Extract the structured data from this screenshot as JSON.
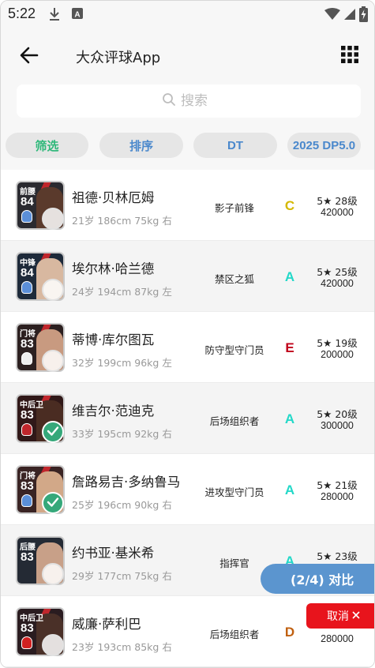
{
  "status_bar": {
    "time": "5:22",
    "icons": [
      "download-icon",
      "keyboard-a-icon",
      "wifi-icon",
      "signal-icon",
      "battery-charging-icon"
    ]
  },
  "app_bar": {
    "title": "大众评球App",
    "back_icon": "arrow-left-icon",
    "menu_icon": "grid-icon"
  },
  "search": {
    "placeholder": "搜索",
    "icon": "search-icon"
  },
  "chips": [
    {
      "label": "筛选",
      "color": "#2fb87a"
    },
    {
      "label": "排序",
      "color": "#4a88cc"
    },
    {
      "label": "DT",
      "color": "#4a88cc"
    },
    {
      "label": "2025 DP5.0",
      "color": "#4a88cc"
    }
  ],
  "players": [
    {
      "card_pos": "前腰",
      "card_rating": "84",
      "name": "祖德·贝林厄姆",
      "meta": "21岁 186cm 75kg 右",
      "role": "影子前锋",
      "grade": "C",
      "grade_color": "#d4b800",
      "level": "5★ 28级",
      "price": "420000",
      "selected": false
    },
    {
      "card_pos": "中锋",
      "card_rating": "84",
      "name": "埃尔林·哈兰德",
      "meta": "24岁 194cm 87kg 左",
      "role": "禁区之狐",
      "grade": "A",
      "grade_color": "#22d8c8",
      "level": "5★ 25级",
      "price": "420000",
      "selected": false
    },
    {
      "card_pos": "门将",
      "card_rating": "83",
      "name": "蒂博·库尔图瓦",
      "meta": "32岁 199cm 96kg 左",
      "role": "防守型守门员",
      "grade": "E",
      "grade_color": "#c0001a",
      "level": "5★ 19级",
      "price": "200000",
      "selected": false
    },
    {
      "card_pos": "中后卫",
      "card_rating": "83",
      "name": "维吉尔·范迪克",
      "meta": "33岁 195cm 92kg 右",
      "role": "后场组织者",
      "grade": "A",
      "grade_color": "#22d8c8",
      "level": "5★ 20级",
      "price": "300000",
      "selected": true
    },
    {
      "card_pos": "门将",
      "card_rating": "83",
      "name": "詹路易吉·多纳鲁马",
      "meta": "25岁 196cm 90kg 右",
      "role": "进攻型守门员",
      "grade": "A",
      "grade_color": "#22d8c8",
      "level": "5★ 21级",
      "price": "280000",
      "selected": true
    },
    {
      "card_pos": "后腰",
      "card_rating": "83",
      "name": "约书亚·基米希",
      "meta": "29岁 177cm 75kg 右",
      "role": "指挥官",
      "grade": "A",
      "grade_color": "#22d8c8",
      "level": "5★ 23级",
      "price": "",
      "selected": false
    },
    {
      "card_pos": "中后卫",
      "card_rating": "83",
      "name": "威廉·萨利巴",
      "meta": "23岁 193cm 85kg 右",
      "role": "后场组织者",
      "grade": "D",
      "grade_color": "#c06010",
      "level": "",
      "price": "280000",
      "selected": false
    }
  ],
  "compare_button": {
    "label": "(2/4) 对比"
  },
  "cancel_button": {
    "label": "取消",
    "icon": "close-icon"
  }
}
